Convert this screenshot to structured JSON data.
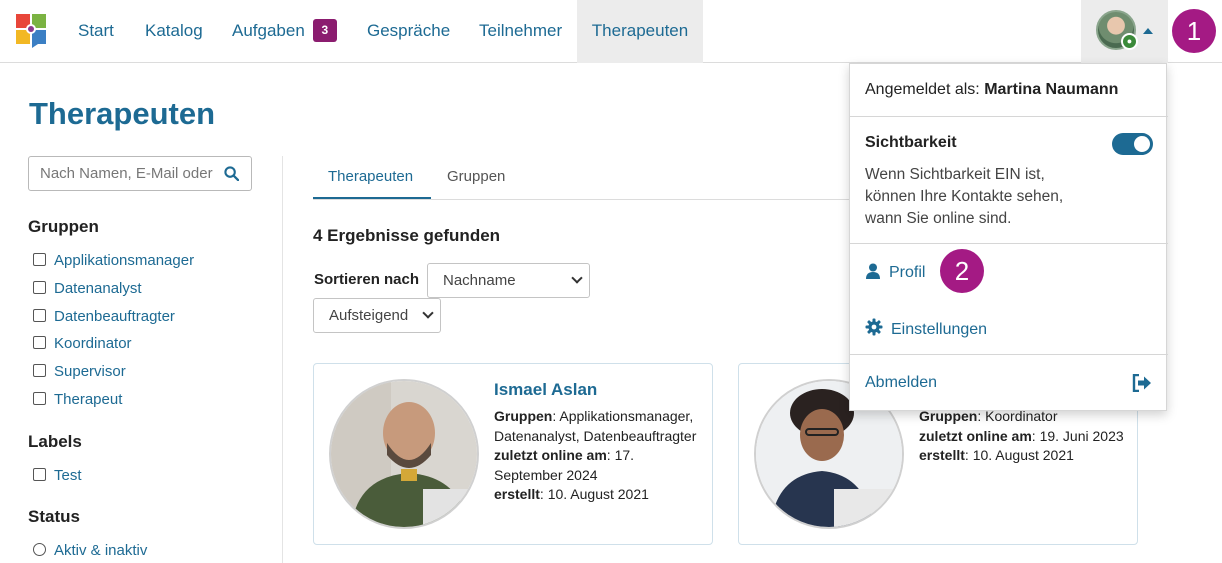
{
  "nav": {
    "items": [
      {
        "label": "Start"
      },
      {
        "label": "Katalog"
      },
      {
        "label": "Aufgaben",
        "badge": "3"
      },
      {
        "label": "Gespräche"
      },
      {
        "label": "Teilnehmer"
      },
      {
        "label": "Therapeuten",
        "active": true
      }
    ]
  },
  "callouts": {
    "one": "1",
    "two": "2"
  },
  "page": {
    "title": "Therapeuten"
  },
  "search": {
    "placeholder": "Nach Namen, E-Mail oder"
  },
  "filters": {
    "groups_heading": "Gruppen",
    "groups": [
      "Applikationsmanager",
      "Datenanalyst",
      "Datenbeauftragter",
      "Koordinator",
      "Supervisor",
      "Therapeut"
    ],
    "labels_heading": "Labels",
    "labels": [
      "Test"
    ],
    "status_heading": "Status",
    "status": [
      "Aktiv & inaktiv"
    ]
  },
  "tabs": [
    {
      "label": "Therapeuten",
      "active": true
    },
    {
      "label": "Gruppen"
    }
  ],
  "results": {
    "text": "4 Ergebnisse gefunden"
  },
  "sort": {
    "label": "Sortieren nach",
    "field": "Nachname",
    "order": "Aufsteigend"
  },
  "cards": [
    {
      "name": "Ismael Aslan",
      "groups_label": "Gruppen",
      "groups_value": ": Applikationsmanager, Datenanalyst, Datenbeauftragter",
      "online_label": "zuletzt online am",
      "online_value": ": 17. September 2024",
      "created_label": "erstellt",
      "created_value": ": 10. August 2021"
    },
    {
      "name": "",
      "groups_label": "Gruppen",
      "groups_value": ": Koordinator",
      "online_label": "zuletzt online am",
      "online_value": ": 19. Juni 2023",
      "created_label": "erstellt",
      "created_value": ": 10. August 2021"
    }
  ],
  "user_menu": {
    "logged_in_prefix": "Angemeldet als:",
    "user_name": "Martina Naumann",
    "visibility_title": "Sichtbarkeit",
    "visibility_on": true,
    "visibility_line1": "Wenn Sichtbarkeit EIN ist,",
    "visibility_line2": "können Ihre Kontakte sehen,",
    "visibility_line3": "wann Sie online sind.",
    "profile": "Profil",
    "settings": "Einstellungen",
    "logout": "Abmelden"
  },
  "colors": {
    "accent": "#1d6a93",
    "badge": "#8b1c6f",
    "callout": "#a41a84"
  }
}
